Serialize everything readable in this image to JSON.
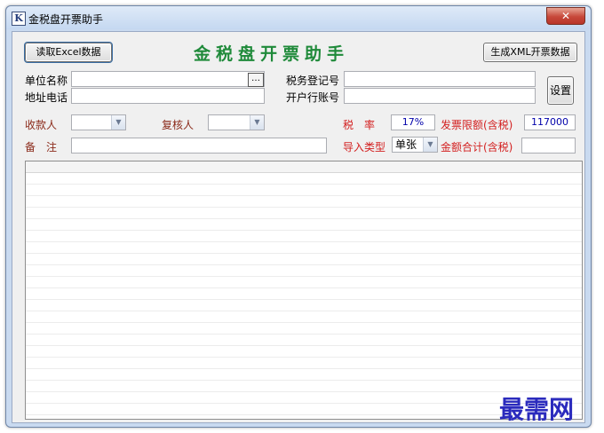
{
  "window": {
    "title": "金税盘开票助手",
    "icon_letter": "K",
    "close_glyph": "✕"
  },
  "toolbar": {
    "read_excel_label": "读取Excel数据",
    "generate_xml_label": "生成XML开票数据",
    "heading": "金税盘开票助手",
    "settings_label": "设置"
  },
  "form": {
    "company_name_label": "单位名称",
    "company_name_value": "",
    "browse_glyph": "…",
    "address_phone_label": "地址电话",
    "address_phone_value": "",
    "tax_id_label": "税务登记号",
    "tax_id_value": "",
    "bank_account_label": "开户行账号",
    "bank_account_value": "",
    "payee_label": "收款人",
    "payee_value": "",
    "reviewer_label": "复核人",
    "reviewer_value": "",
    "tax_rate_label": "税　率",
    "tax_rate_value": "17%",
    "invoice_limit_label": "发票限额(含税)",
    "invoice_limit_value": "117000",
    "remark_label": "备　注",
    "remark_value": "",
    "import_type_label": "导入类型",
    "import_type_value": "单张",
    "total_amount_label": "金额合计(含税)",
    "total_amount_value": ""
  },
  "watermark": "最需网",
  "colors": {
    "heading_green": "#1f8a3a",
    "label_red": "#d32020",
    "label_brown": "#8b2a1a",
    "value_blue": "#0000aa",
    "watermark_blue": "#2b2bbd"
  }
}
